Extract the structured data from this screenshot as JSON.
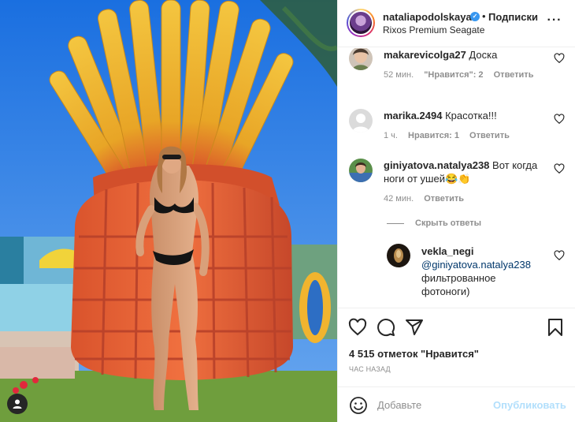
{
  "post": {
    "username": "nataliapodolskaya",
    "verified_mark": "✓",
    "separator": "•",
    "follow_label": "Подписки",
    "location": "Rixos Premium Seagate",
    "more_label": "···"
  },
  "comments": [
    {
      "username": "makarevicolga27",
      "text": "Доска",
      "age": "52 мин.",
      "likes": "\"Нравится\": 2",
      "reply": "Ответить"
    },
    {
      "username": "marika.2494",
      "text": "Красотка!!!",
      "age": "1 ч.",
      "likes": "Нравится: 1",
      "reply": "Ответить"
    },
    {
      "username": "giniyatova.natalya238",
      "text": "Вот когда ноги от ушей😂👏",
      "text_line1": "Вот когда",
      "text_line2": "ноги от ушей😂👏",
      "age": "42 мин.",
      "reply": "Ответить"
    }
  ],
  "hide_replies": "Скрыть ответы",
  "reply": {
    "username": "vekla_negi",
    "mention": "@giniyatova.natalya238",
    "text_line1": "фильтрованное",
    "text_line2": "фотоноги)"
  },
  "likes_count": "4 515 отметок \"Нравится\"",
  "time_ago": "ЧАС НАЗАД",
  "comment_box": {
    "placeholder": "Добавьте",
    "post_label": "Опубликовать"
  },
  "icons": [
    "user-tag-icon",
    "more-icon",
    "heart-icon",
    "comment-icon",
    "share-icon",
    "bookmark-icon",
    "emoji-icon"
  ],
  "colors": {
    "link": "#00376b",
    "muted": "#8e8e8e",
    "post_disabled": "#b2dffc",
    "verified": "#3897f0"
  }
}
